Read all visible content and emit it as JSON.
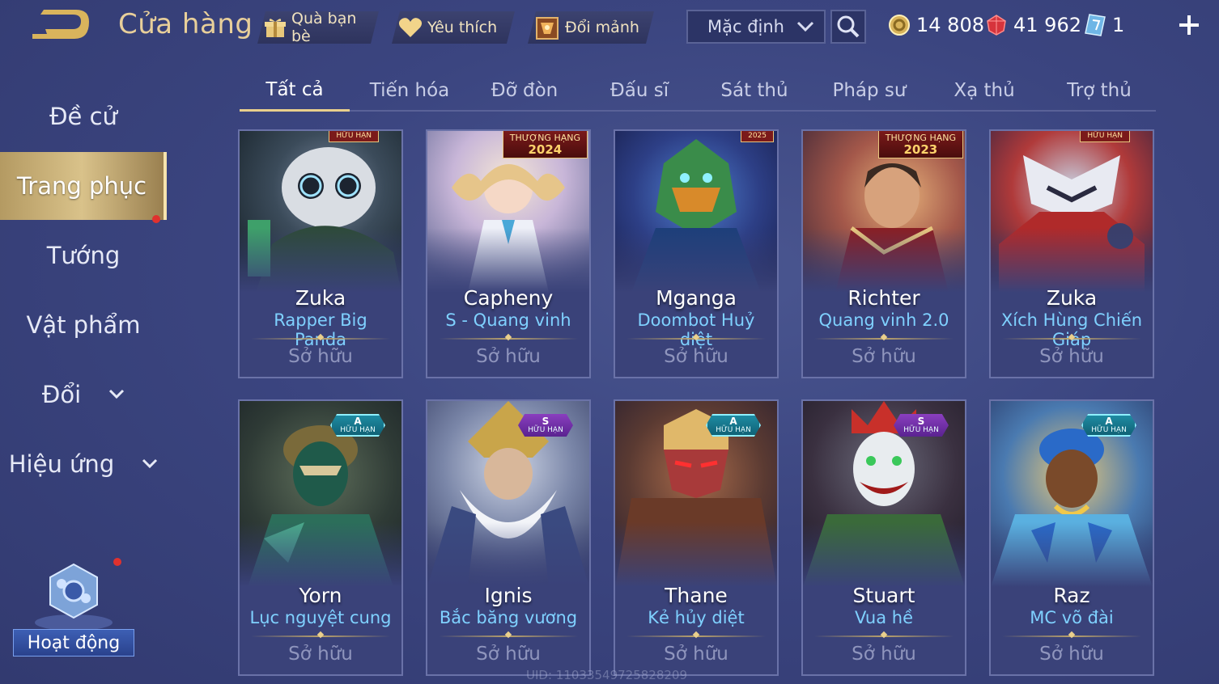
{
  "header": {
    "title": "Cửa hàng",
    "friend_gift": "Quà bạn bè",
    "favorite": "Yêu thích",
    "fragments": "Đổi mảnh",
    "sort_value": "Mặc định",
    "gold": "14 808",
    "gems": "41 962",
    "tickets": "1"
  },
  "sidebar": {
    "items": [
      {
        "label": "Đề cử"
      },
      {
        "label": "Trang phục"
      },
      {
        "label": "Tướng"
      },
      {
        "label": "Vật phẩm"
      },
      {
        "label": "Đổi"
      },
      {
        "label": "Hiệu ứng"
      }
    ],
    "event_label": "Hoạt động"
  },
  "tabs": [
    "Tất cả",
    "Tiến hóa",
    "Đỡ đòn",
    "Đấu sĩ",
    "Sát thủ",
    "Pháp sư",
    "Xạ thủ",
    "Trợ thủ"
  ],
  "cards": [
    {
      "hero": "Zuka",
      "skin": "Rapper Big Panda",
      "status": "Sở hữu",
      "badge": "HỮU HẠN"
    },
    {
      "hero": "Capheny",
      "skin": "S - Quang vinh",
      "status": "Sở hữu",
      "badge_l1": "THƯỢNG HẠNG",
      "badge_l2": "2024"
    },
    {
      "hero": "Mganga",
      "skin": "Doombot Huỷ diệt",
      "status": "Sở hữu",
      "badge": "2025"
    },
    {
      "hero": "Richter",
      "skin": "Quang vinh 2.0",
      "status": "Sở hữu",
      "badge_l1": "THƯỢNG HẠNG",
      "badge_l2": "2023"
    },
    {
      "hero": "Zuka",
      "skin": "Xích Hùng Chiến Giáp",
      "status": "Sở hữu",
      "badge": "HỮU HẠN"
    },
    {
      "hero": "Yorn",
      "skin": "Lục nguyệt cung",
      "status": "Sở hữu",
      "grade": "A",
      "badge": "HỮU HẠN"
    },
    {
      "hero": "Ignis",
      "skin": "Bắc băng vương",
      "status": "Sở hữu",
      "grade": "S",
      "badge": "HỮU HẠN"
    },
    {
      "hero": "Thane",
      "skin": "Kẻ hủy diệt",
      "status": "Sở hữu",
      "grade": "A",
      "badge": "HỮU HẠN"
    },
    {
      "hero": "Stuart",
      "skin": "Vua hề",
      "status": "Sở hữu",
      "grade": "S",
      "badge": "HỮU HẠN"
    },
    {
      "hero": "Raz",
      "skin": "MC võ đài",
      "status": "Sở hữu",
      "grade": "A",
      "badge": "HỮU HẠN"
    }
  ],
  "footer": {
    "uid": "UID: 1103354972582820​9"
  },
  "colors": {
    "accent_gold": "#e8cf9a",
    "skin_name": "#7fd1ff",
    "background": "#3b4580"
  }
}
